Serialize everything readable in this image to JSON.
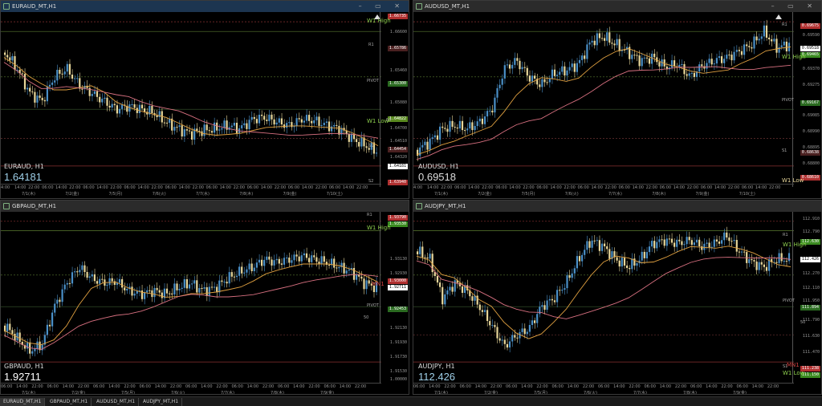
{
  "windows": [
    {
      "title": "EURAUD_MT,H1",
      "symbol": "EURAUD, H1",
      "price": "1.64181",
      "ticks": [
        "1.66735",
        "1.66600",
        "1.65786",
        "1.65460",
        "1.65300",
        "1.65080",
        "1.64822",
        "1.64700",
        "1.64510",
        "1.64454",
        "1.64320",
        "1.64181",
        "1.63940"
      ],
      "levels": {
        "w1high": "W1 High",
        "r1": "R1",
        "pivot": "PIVOT",
        "w1low": "W1 Low",
        "s1": "S1",
        "s2": "S2",
        "n50": "50"
      },
      "xlabels": [
        "4:00",
        "14:00",
        "22:00",
        "06:00",
        "14:00",
        "22:00",
        "06:00",
        "14:00",
        "22:00",
        "06:00",
        "14:00",
        "22:00",
        "06:00",
        "14:00",
        "22:00",
        "06:00",
        "14:00",
        "22:00",
        "06:00",
        "14:00",
        "22:00",
        "06:00",
        "14:00",
        "22:00",
        "06:00",
        "14:00",
        "22:00"
      ],
      "dates": [
        "7/1(木)",
        "7/2(金)",
        "7/5(月)",
        "7/6(火)",
        "7/7(水)",
        "7/8(木)",
        "7/9(金)",
        "7/10(土)"
      ]
    },
    {
      "title": "AUDUSD_MT,H1",
      "symbol": "AUDUSD, H1",
      "price": "0.69518",
      "ticks": [
        "0.69675",
        "0.69590",
        "0.69518",
        "0.69465",
        "0.69370",
        "0.69275",
        "0.69167",
        "0.69085",
        "0.68990",
        "0.68895",
        "0.68800",
        "0.68705",
        "0.68638",
        "0.68610"
      ],
      "levels": {
        "w1high": "W1 High",
        "r1": "R1",
        "pivot": "PIVOT",
        "w1low": "W1 Low",
        "s1": "S1",
        "n50": "50"
      },
      "xlabels": [
        "4:00",
        "14:00",
        "22:00",
        "06:00",
        "14:00",
        "22:00",
        "06:00",
        "14:00",
        "22:00",
        "06:00",
        "14:00",
        "22:00",
        "06:00",
        "14:00",
        "22:00",
        "06:00",
        "14:00",
        "22:00",
        "06:00",
        "14:00",
        "22:00",
        "06:00",
        "14:00",
        "22:00",
        "06:00",
        "14:00",
        "22:00"
      ],
      "dates": [
        "7/1(木)",
        "7/2(金)",
        "7/5(月)",
        "7/6(火)",
        "7/7(水)",
        "7/8(木)",
        "7/9(金)",
        "7/10(土)"
      ]
    },
    {
      "title": "GBPAUD_MT,H1",
      "symbol": "GBPAUD, H1",
      "price": "1.92711",
      "ticks": [
        "1.93790",
        "1.93530",
        "1.93130",
        "1.93000",
        "1.92930",
        "1.92711",
        "1.92453",
        "1.92330",
        "1.92130",
        "1.91930",
        "1.91730",
        "1.91530",
        "1.91330",
        "1.00000"
      ],
      "levels": {
        "w1high": "W1 High",
        "r1": "R1",
        "pivot": "PIVOT",
        "mn1": "MN1",
        "n50": "50"
      },
      "xlabels": [
        "06:00",
        "14:00",
        "22:00",
        "06:00",
        "14:00",
        "22:00",
        "06:00",
        "14:00",
        "22:00",
        "06:00",
        "14:00",
        "22:00",
        "06:00",
        "14:00",
        "22:00",
        "06:00",
        "14:00",
        "22:00",
        "06:00",
        "14:00",
        "22:00",
        "06:00",
        "14:00",
        "22:00"
      ],
      "dates": [
        "7/1(木)",
        "7/2(金)",
        "7/5(月)",
        "7/6(火)",
        "7/7(水)",
        "7/8(木)",
        "7/9(金)"
      ]
    },
    {
      "title": "AUDJPY_MT,H1",
      "symbol": "AUDJPY, H1",
      "price": "112.426",
      "ticks": [
        "112.910",
        "112.790",
        "112.630",
        "112.426",
        "112.270",
        "112.110",
        "111.950",
        "111.894",
        "111.790",
        "111.630",
        "111.470",
        "111.310",
        "111.238",
        "111.150"
      ],
      "levels": {
        "w1high": "W1 High",
        "r1": "R1",
        "pivot": "PIVOT",
        "mn1": "MN1",
        "w1low": "W1 Low",
        "s1": "S1",
        "n50": "50"
      },
      "xlabels": [
        "06:00",
        "14:00",
        "22:00",
        "06:00",
        "14:00",
        "22:00",
        "06:00",
        "14:00",
        "22:00",
        "06:00",
        "14:00",
        "22:00",
        "06:00",
        "14:00",
        "22:00",
        "06:00",
        "14:00",
        "22:00",
        "06:00",
        "14:00",
        "22:00",
        "06:00",
        "14:00",
        "22:00"
      ],
      "dates": [
        "7/1(木)",
        "7/2(金)",
        "7/5(月)",
        "7/6(火)",
        "7/7(水)",
        "7/8(木)",
        "7/9(金)"
      ]
    }
  ],
  "tabs": [
    "EURAUD_MT,H1",
    "GBPAUD_MT,H1",
    "AUDUSD_MT,H1",
    "AUDJPY_MT,H1"
  ],
  "colors": {
    "bull": "#4a90c8",
    "bear": "#e8d79a",
    "ma_fast": "#e0a040",
    "ma_slow": "#d87080",
    "level_green": "#8fd14f",
    "level_red": "#d04040",
    "highlight": "#e8e000"
  }
}
